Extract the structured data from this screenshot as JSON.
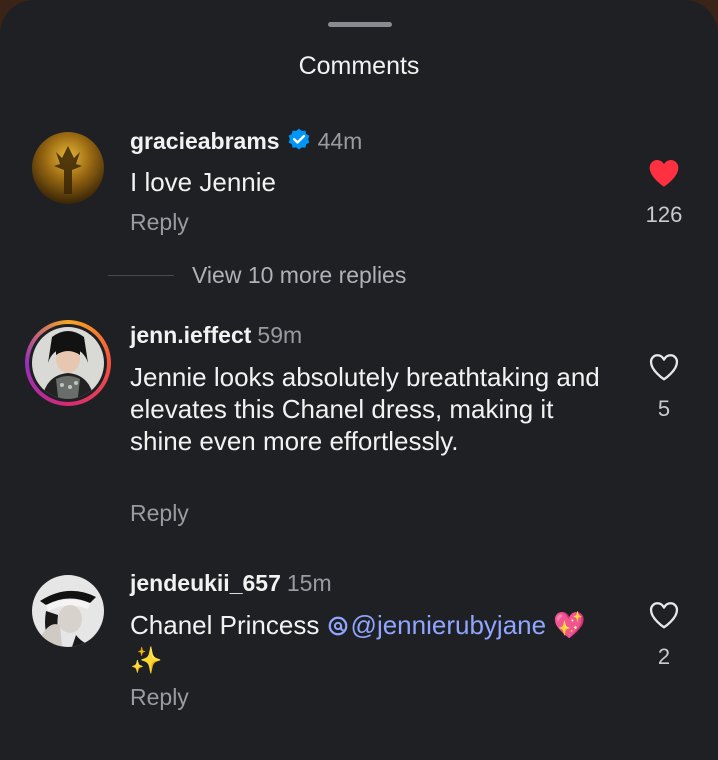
{
  "sheet": {
    "title": "Comments"
  },
  "comments": [
    {
      "username": "gracieabrams",
      "verified": true,
      "time": "44m",
      "text": "I love Jennie",
      "reply_label": "Reply",
      "likes": "126",
      "liked": true,
      "view_more": "View 10 more replies"
    },
    {
      "username": "jenn.ieffect",
      "verified": false,
      "time": "59m",
      "text": "Jennie looks absolutely breathtaking and elevates this Chanel dress, making it shine even more effortlessly.",
      "reply_label": "Reply",
      "likes": "5",
      "liked": false,
      "has_story": true
    },
    {
      "username": "jendeukii_657",
      "verified": false,
      "time": "15m",
      "text_before": "Chanel Princess ",
      "mention": "@jennierubyjane",
      "emoji": "💖 ✨",
      "reply_label": "Reply",
      "likes": "2",
      "liked": false
    }
  ],
  "colors": {
    "sheet_bg": "#1f2024",
    "text_primary": "#f2f2f2",
    "text_secondary": "#9a9ba0",
    "like_red": "#ff3040",
    "verified_blue": "#0095f6",
    "mention": "#8fa5ff"
  },
  "icons": [
    "verified-badge-icon",
    "heart-filled-icon",
    "heart-outline-icon",
    "threads-icon"
  ]
}
